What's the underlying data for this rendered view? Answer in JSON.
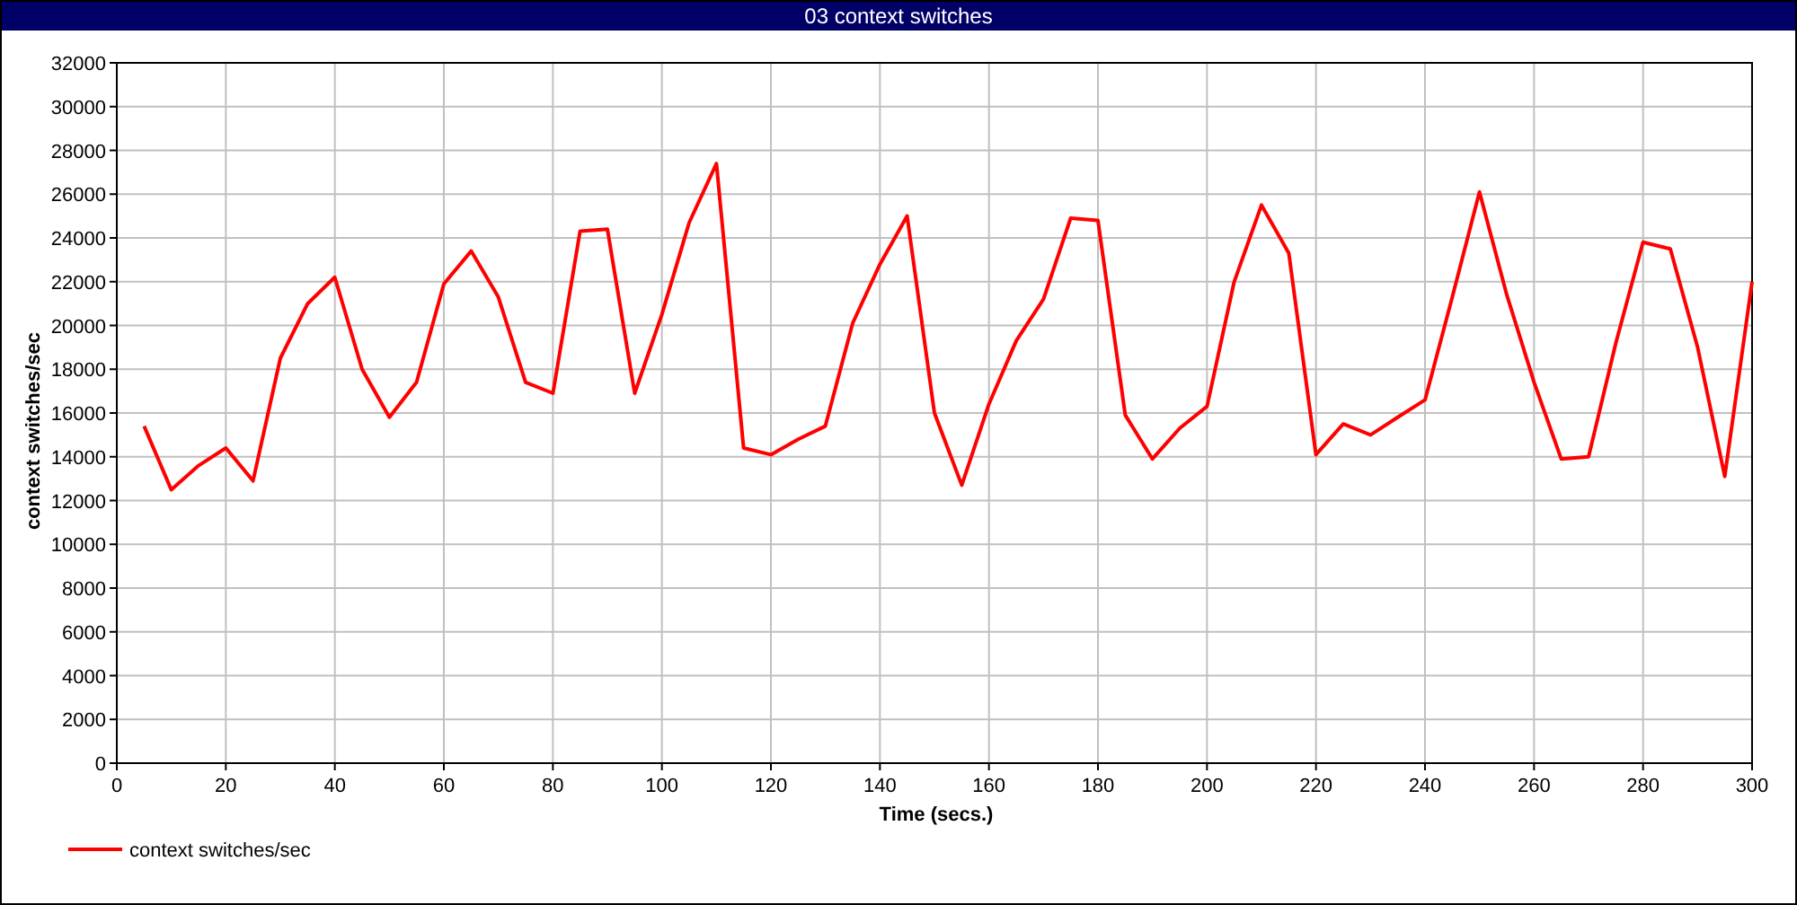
{
  "window": {
    "title": "03 context switches"
  },
  "chart_data": {
    "type": "line",
    "xlabel": "Time (secs.)",
    "ylabel": "context switches/sec",
    "x": [
      5,
      10,
      15,
      20,
      25,
      30,
      35,
      40,
      45,
      50,
      55,
      60,
      65,
      70,
      75,
      80,
      85,
      90,
      95,
      100,
      105,
      110,
      115,
      120,
      125,
      130,
      135,
      140,
      145,
      150,
      155,
      160,
      165,
      170,
      175,
      180,
      185,
      190,
      195,
      200,
      205,
      210,
      215,
      220,
      225,
      230,
      235,
      240,
      245,
      250,
      255,
      260,
      265,
      270,
      275,
      280,
      285,
      290,
      295,
      300
    ],
    "series": [
      {
        "name": "context switches/sec",
        "color": "#ff0000",
        "values": [
          15400,
          12500,
          13600,
          14400,
          12900,
          18500,
          21000,
          22200,
          18000,
          15800,
          17400,
          21900,
          23400,
          21300,
          17400,
          16900,
          24300,
          24400,
          16900,
          20500,
          24700,
          27400,
          14400,
          14100,
          14800,
          15400,
          20100,
          22800,
          25000,
          16000,
          12700,
          16400,
          19300,
          21200,
          24900,
          24800,
          15900,
          13900,
          15300,
          16300,
          22000,
          25500,
          23300,
          14100,
          15500,
          15000,
          15800,
          16600,
          21300,
          26100,
          21400,
          17400,
          13900,
          14000,
          19200,
          23800,
          23500,
          19000,
          13100,
          22000
        ]
      }
    ],
    "grid": true,
    "xlim": [
      0,
      300
    ],
    "ylim": [
      0,
      32000
    ],
    "xticks": [
      0,
      20,
      40,
      60,
      80,
      100,
      120,
      140,
      160,
      180,
      200,
      220,
      240,
      260,
      280,
      300
    ],
    "yticks": [
      0,
      2000,
      4000,
      6000,
      8000,
      10000,
      12000,
      14000,
      16000,
      18000,
      20000,
      22000,
      24000,
      26000,
      28000,
      30000,
      32000
    ]
  }
}
